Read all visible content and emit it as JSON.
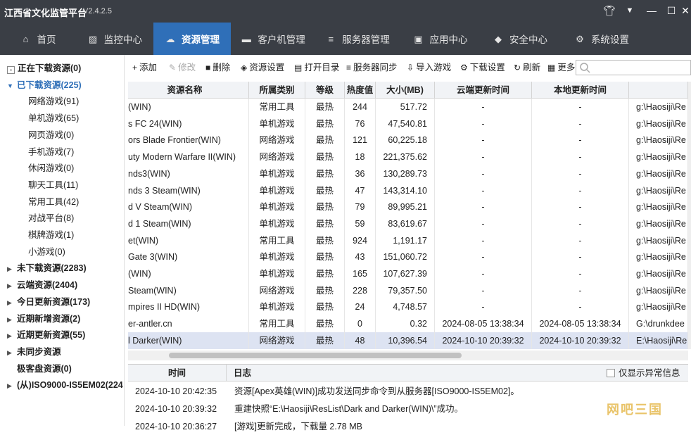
{
  "app": {
    "title": "江西省文化监管平台",
    "version": "V2.4.2.5"
  },
  "nav": [
    {
      "label": "首页",
      "icon": "home-icon"
    },
    {
      "label": "监控中心",
      "icon": "monitor-chart-icon"
    },
    {
      "label": "资源管理",
      "icon": "cloud-icon"
    },
    {
      "label": "客户机管理",
      "icon": "computer-icon"
    },
    {
      "label": "服务器管理",
      "icon": "server-icon"
    },
    {
      "label": "应用中心",
      "icon": "app-icon"
    },
    {
      "label": "安全中心",
      "icon": "shield-icon"
    },
    {
      "label": "系统设置",
      "icon": "gear-icon"
    }
  ],
  "sidebar": [
    {
      "label": "正在下载资源(0)",
      "bold": true,
      "mark": "checkbox-minus"
    },
    {
      "label": "已下载资源(225)",
      "bold": true,
      "mark": "expanded"
    },
    {
      "label": "网络游戏(91)"
    },
    {
      "label": "单机游戏(65)"
    },
    {
      "label": "网页游戏(0)"
    },
    {
      "label": "手机游戏(7)"
    },
    {
      "label": "休闲游戏(0)"
    },
    {
      "label": "聊天工具(11)"
    },
    {
      "label": "常用工具(42)"
    },
    {
      "label": "对战平台(8)"
    },
    {
      "label": "棋牌游戏(1)"
    },
    {
      "label": "小游戏(0)"
    },
    {
      "label": "未下载资源(2283)",
      "bold": true,
      "mark": "collapsed"
    },
    {
      "label": "云端资源(2404)",
      "bold": true,
      "mark": "collapsed"
    },
    {
      "label": "今日更新资源(173)",
      "bold": true,
      "mark": "collapsed"
    },
    {
      "label": "近期新增资源(2)",
      "bold": true,
      "mark": "collapsed"
    },
    {
      "label": "近期更新资源(55)",
      "bold": true,
      "mark": "collapsed"
    },
    {
      "label": "未同步资源",
      "bold": true,
      "mark": "collapsed"
    },
    {
      "label": "极客盘资源(0)",
      "bold": true,
      "mark": "none"
    },
    {
      "label": "(从)ISO9000-IS5EM02(224",
      "bold": true,
      "mark": "collapsed"
    }
  ],
  "toolbar": [
    {
      "label": "添加",
      "icon": "plus-icon"
    },
    {
      "label": "修改",
      "icon": "edit-icon",
      "disabled": true
    },
    {
      "label": "删除",
      "icon": "trash-icon"
    },
    {
      "label": "资源设置",
      "icon": "layers-icon"
    },
    {
      "label": "打开目录",
      "icon": "folder-icon"
    },
    {
      "label": "服务器同步",
      "icon": "server-icon"
    },
    {
      "label": "导入游戏",
      "icon": "import-icon"
    },
    {
      "label": "下载设置",
      "icon": "gear-icon"
    },
    {
      "label": "刷新",
      "icon": "refresh-icon"
    },
    {
      "label": "更多",
      "icon": "grid-icon"
    }
  ],
  "table": {
    "headers": [
      "资源名称",
      "所属类别",
      "等级",
      "热度值",
      "大小(MB)",
      "云端更新时间",
      "本地更新时间",
      ""
    ],
    "rows": [
      [
        "(WIN)",
        "常用工具",
        "最热",
        "244",
        "517.72",
        "-",
        "-",
        "g:\\Haosiji\\Re"
      ],
      [
        "s FC 24(WIN)",
        "单机游戏",
        "最热",
        "76",
        "47,540.81",
        "-",
        "-",
        "g:\\Haosiji\\Re"
      ],
      [
        "ors Blade Frontier(WIN)",
        "网络游戏",
        "最热",
        "121",
        "60,225.18",
        "-",
        "-",
        "g:\\Haosiji\\Re"
      ],
      [
        "uty Modern Warfare II(WIN)",
        "网络游戏",
        "最热",
        "18",
        "221,375.62",
        "-",
        "-",
        "g:\\Haosiji\\Re"
      ],
      [
        "nds3(WIN)",
        "单机游戏",
        "最热",
        "36",
        "130,289.73",
        "-",
        "-",
        "g:\\Haosiji\\Re"
      ],
      [
        "nds 3 Steam(WIN)",
        "单机游戏",
        "最热",
        "47",
        "143,314.10",
        "-",
        "-",
        "g:\\Haosiji\\Re"
      ],
      [
        "d V Steam(WIN)",
        "单机游戏",
        "最热",
        "79",
        "89,995.21",
        "-",
        "-",
        "g:\\Haosiji\\Re"
      ],
      [
        "d 1 Steam(WIN)",
        "单机游戏",
        "最热",
        "59",
        "83,619.67",
        "-",
        "-",
        "g:\\Haosiji\\Re"
      ],
      [
        "et(WIN)",
        "常用工具",
        "最热",
        "924",
        "1,191.17",
        "-",
        "-",
        "g:\\Haosiji\\Re"
      ],
      [
        "Gate 3(WIN)",
        "单机游戏",
        "最热",
        "43",
        "151,060.72",
        "-",
        "-",
        "g:\\Haosiji\\Re"
      ],
      [
        "(WIN)",
        "单机游戏",
        "最热",
        "165",
        "107,627.39",
        "-",
        "-",
        "g:\\Haosiji\\Re"
      ],
      [
        " Steam(WIN)",
        "网络游戏",
        "最热",
        "228",
        "79,357.50",
        "-",
        "-",
        "g:\\Haosiji\\Re"
      ],
      [
        "mpires II HD(WIN)",
        "单机游戏",
        "最热",
        "24",
        "4,748.57",
        "-",
        "-",
        "g:\\Haosiji\\Re"
      ],
      [
        "er-antler.cn",
        "常用工具",
        "最热",
        "0",
        "0.32",
        "2024-08-05 13:38:34",
        "2024-08-05 13:38:34",
        "G:\\drunkdee"
      ],
      [
        "l Darker(WIN)",
        "网络游戏",
        "最热",
        "48",
        "10,396.54",
        "2024-10-10 20:39:32",
        "2024-10-10 20:39:32",
        "E:\\Haosiji\\Re"
      ]
    ]
  },
  "log": {
    "headers": [
      "时间",
      "日志"
    ],
    "only_abnormal": "仅显示异常信息",
    "rows": [
      [
        "2024-10-10 20:42:35",
        "资源[Apex英雄(WIN)]成功发送同步命令到从服务器[ISO9000-IS5EM02]。"
      ],
      [
        "2024-10-10 20:39:32",
        "重建快照“E:\\Haosiji\\ResList\\Dark and Darker(WIN)\\”成功。"
      ],
      [
        "2024-10-10 20:36:27",
        "[游戏]更新完成，下载量 2.78 MB"
      ]
    ]
  },
  "watermark": "网吧三国"
}
